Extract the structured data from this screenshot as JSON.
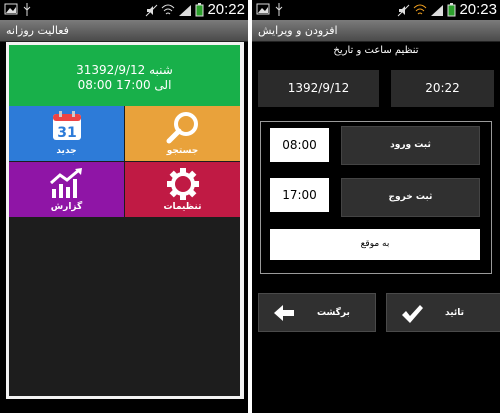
{
  "left_screen": {
    "status_time": "20:22",
    "title": "فعالیت روزانه",
    "summary": {
      "line1": "3شنبه 1392/9/12",
      "line2": "08:00 الی 17:00"
    },
    "tiles": [
      {
        "label": "جدید",
        "icon": "calendar-icon",
        "icon_text": "31",
        "color": "#2d7bd8"
      },
      {
        "label": "جستجو",
        "icon": "search-icon",
        "color": "#e9a23b"
      },
      {
        "label": "گزارش",
        "icon": "chart-icon",
        "color": "#8f15a6"
      },
      {
        "label": "تنظیمات",
        "icon": "gear-icon",
        "color": "#c01a44"
      }
    ]
  },
  "right_screen": {
    "status_time": "20:23",
    "title": "افزودن و ویرایش",
    "heading": "تنظیم ساعت و تاریخ",
    "date": "1392/9/12",
    "time": "20:22",
    "entry": {
      "time": "08:00",
      "button": "ثبت ورود"
    },
    "exit": {
      "time": "17:00",
      "button": "ثبت خروج"
    },
    "on_time_button": "به موقع",
    "back_button": "برگشت",
    "confirm_button": "تائید"
  }
}
